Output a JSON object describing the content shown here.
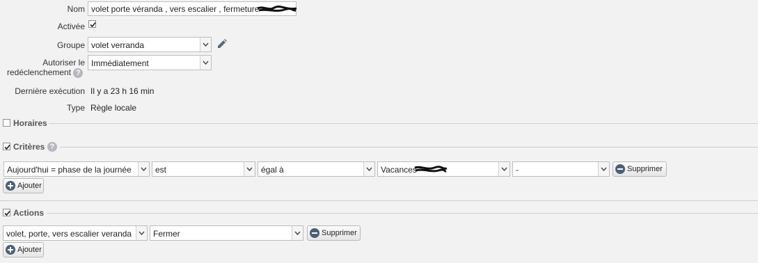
{
  "form": {
    "name_label": "Nom",
    "name_value": "volet porte véranda , vers escalier , fermeture",
    "active_label": "Activée",
    "active_checked": true,
    "group_label": "Groupe",
    "group_value": "volet verranda",
    "retrigger_label_1": "Autoriser le",
    "retrigger_label_2": "redéclenchement",
    "retrigger_value": "Immédiatement",
    "last_exec_label": "Dernière exécution",
    "last_exec_value": "Il y a 23 h 16 min",
    "type_label": "Type",
    "type_value": "Règle locale"
  },
  "sections": {
    "schedules_title": "Horaires",
    "schedules_checked": false,
    "criteria_title": "Critères",
    "criteria_checked": true,
    "actions_title": "Actions",
    "actions_checked": true
  },
  "criteria_row": {
    "field": "Aujourd'hui = phase de la journée",
    "operator": "est",
    "comparison": "égal à",
    "value": "Vacances",
    "extra": "-",
    "delete_label": "Supprimer"
  },
  "criteria_add_label": "Ajouter",
  "action_row": {
    "target": "volet, porte, vers escalier veranda",
    "command": "Fermer",
    "delete_label": "Supprimer"
  },
  "actions_add_label": "Ajouter",
  "icons": {
    "edit": "pencil-icon",
    "help": "question-icon",
    "delete": "minus-circle-icon",
    "add": "plus-circle-icon",
    "dropdown": "chevron-down-icon"
  }
}
